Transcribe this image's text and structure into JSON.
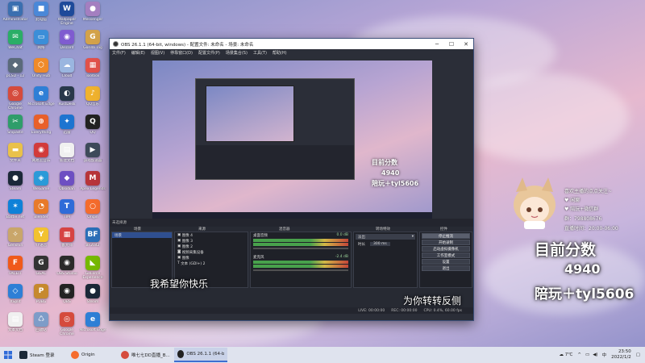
{
  "desktop": {
    "icons": [
      {
        "label": "Administrator",
        "glyph": "▣",
        "color": "#3a6fb0",
        "name": "admin-icon"
      },
      {
        "label": "此电脑",
        "glyph": "■",
        "color": "#4a88d8",
        "name": "this-pc-icon"
      },
      {
        "label": "Wallpaper Engine",
        "glyph": "W",
        "color": "#1e4a9a",
        "name": "wallpaper-engine-icon"
      },
      {
        "label": "Messenger",
        "glyph": "●",
        "color": "#a47fc0",
        "name": "messenger-icon"
      },
      {
        "label": "WeChat",
        "glyph": "✉",
        "color": "#2aae67",
        "name": "wechat-icon"
      },
      {
        "label": "网络",
        "glyph": "▭",
        "color": "#3b8ed8",
        "name": "network-icon"
      },
      {
        "label": "Discord",
        "glyph": "◉",
        "color": "#7f5cd0",
        "name": "discord-icon"
      },
      {
        "label": "Gorilla Tag",
        "glyph": "G",
        "color": "#d3a24a",
        "name": "gorilla-tag-icon"
      },
      {
        "label": "pCSD - 12",
        "glyph": "◆",
        "color": "#5a6a7a",
        "name": "pcsd-icon"
      },
      {
        "label": "Unity Hub",
        "glyph": "⬡",
        "color": "#ef8a2a",
        "name": "unity-hub-icon"
      },
      {
        "label": "Cloud",
        "glyph": "☁",
        "color": "#9ab6e0",
        "name": "cloud-icon"
      },
      {
        "label": "Toolbox",
        "glyph": "▦",
        "color": "#e2514a",
        "name": "toolbox-icon"
      },
      {
        "label": "Google Chrome",
        "glyph": "◎",
        "color": "#d54b3d",
        "name": "chrome-icon"
      },
      {
        "label": "Microsoft Edge",
        "glyph": "e",
        "color": "#2e7fd6",
        "name": "edge-icon"
      },
      {
        "label": "RustDesk",
        "glyph": "◐",
        "color": "#28384a",
        "name": "rustdesk-icon"
      },
      {
        "label": "QQ音乐",
        "glyph": "♪",
        "color": "#f0b22e",
        "name": "qqmusic-icon"
      },
      {
        "label": "Snipaste",
        "glyph": "✂",
        "color": "#2f9d6a",
        "name": "snipaste-icon"
      },
      {
        "label": "Everything",
        "glyph": "⊕",
        "color": "#e8602a",
        "name": "everything-icon"
      },
      {
        "label": "迅雷",
        "glyph": "✦",
        "color": "#1d74d0",
        "name": "xunlei-icon"
      },
      {
        "label": "QQ",
        "glyph": "Q",
        "color": "#222",
        "name": "qq-icon"
      },
      {
        "label": "文件夹",
        "glyph": "▬",
        "color": "#e9c14a",
        "name": "folder-icon"
      },
      {
        "label": "网易云音乐",
        "glyph": "◉",
        "color": "#d23b3b",
        "name": "netease-icon"
      },
      {
        "label": "新建文档",
        "glyph": "▤",
        "color": "#f0f0f0",
        "name": "new-doc-icon"
      },
      {
        "label": "游戏加速器",
        "glyph": "▶",
        "color": "#3e4a5a",
        "name": "accelerator-icon"
      },
      {
        "label": "Steam",
        "glyph": "●",
        "color": "#1b2838",
        "name": "steam-icon"
      },
      {
        "label": "WeGame",
        "glyph": "◈",
        "color": "#2a9ad8",
        "name": "wegame-icon"
      },
      {
        "label": "Obsidian",
        "glyph": "◆",
        "color": "#6d4fc2",
        "name": "obsidian-icon"
      },
      {
        "label": "Apex Legends",
        "glyph": "M",
        "color": "#b8353a",
        "name": "apex-icon"
      },
      {
        "label": "Battle.net",
        "glyph": "✶",
        "color": "#0e81d8",
        "name": "battlenet-icon"
      },
      {
        "label": "Blender",
        "glyph": "◔",
        "color": "#e87a2a",
        "name": "blender-icon"
      },
      {
        "label": "TIM",
        "glyph": "T",
        "color": "#2f6bd8",
        "name": "tim-icon"
      },
      {
        "label": "Origin",
        "glyph": "○",
        "color": "#f56c2d",
        "name": "origin-icon"
      },
      {
        "label": "Genshin",
        "glyph": "✧",
        "color": "#c9a66a",
        "name": "genshin-icon"
      },
      {
        "label": "YY语音",
        "glyph": "Y",
        "color": "#f2c230",
        "name": "yy-icon"
      },
      {
        "label": "鲁大师",
        "glyph": "▦",
        "color": "#d64343",
        "name": "ludashi-icon"
      },
      {
        "label": "BF2042",
        "glyph": "BF",
        "color": "#2c6fb8",
        "name": "bf-icon"
      },
      {
        "label": "FACEIT",
        "glyph": "F",
        "color": "#f05a1a",
        "name": "faceit-icon"
      },
      {
        "label": "GGAC",
        "glyph": "G",
        "color": "#333",
        "name": "ggac-icon"
      },
      {
        "label": "OBS Studio",
        "glyph": "◉",
        "color": "#2a2a2a",
        "name": "obs-desktop-icon"
      },
      {
        "label": "GeForce Experience",
        "glyph": "◣",
        "color": "#76b900",
        "name": "geforce-icon"
      },
      {
        "label": "XSplit",
        "glyph": "◇",
        "color": "#2e7fd6",
        "name": "xsplit-icon"
      },
      {
        "label": "PUBG",
        "glyph": "P",
        "color": "#c6892e",
        "name": "pubg-icon"
      },
      {
        "label": "OBS",
        "glyph": "◉",
        "color": "#222",
        "name": "obs2-icon"
      },
      {
        "label": "Steam",
        "glyph": "●",
        "color": "#1b2838",
        "name": "steam2-icon"
      },
      {
        "label": "文本文档",
        "glyph": "▤",
        "color": "#f0f0f0",
        "name": "text-doc-icon"
      },
      {
        "label": "回收站",
        "glyph": "♺",
        "color": "#7d9cc8",
        "name": "recycle-bin-icon"
      },
      {
        "label": "Google Chrome",
        "glyph": "◎",
        "color": "#d54b3d",
        "name": "chrome2-icon"
      },
      {
        "label": "Microsoft Edge",
        "glyph": "e",
        "color": "#2e7fd6",
        "name": "edge2-icon"
      }
    ]
  },
  "obs": {
    "title": "OBS 26.1.1 (64-bit, windows) - 配置文件: 未命名 - 场景: 未命名",
    "menu": [
      "文件(F)",
      "编辑(E)",
      "视图(V)",
      "停靠窗口(D)",
      "配置文件(P)",
      "场景集合(S)",
      "工具(T)",
      "帮助(H)"
    ],
    "scene_bar": "未选择源",
    "docks": {
      "scenes_header": "场景",
      "sources_header": "来源",
      "mixer_header": "混音器",
      "transitions_header": "转场特效",
      "controls_header": "控件"
    },
    "scenes": [
      "场景"
    ],
    "sources": [
      "图像 4",
      "图像 3",
      "图像 2",
      "视频采集设备",
      "图像",
      "文本 (GDI+) 2"
    ],
    "mixer": [
      {
        "name": "桌面音频",
        "value": "0.0 dB"
      },
      {
        "name": "麦克风",
        "value": "-2.4 dB"
      }
    ],
    "transition": {
      "type": "淡出",
      "duration_label": "时长",
      "duration": "300 ms"
    },
    "controls": [
      "停止推流",
      "开始录制",
      "启动虚拟摄像机",
      "工作室模式",
      "设置",
      "退出"
    ],
    "status": [
      "LIVE: 00:00:00",
      "REC: 00:00:00",
      "CPU: 0.4%, 60.00 fps"
    ]
  },
  "subtitles": {
    "line1": "我希望你快乐",
    "line2": "为你转转反侧"
  },
  "overlay": {
    "info": [
      "喜欢主播的点点关注~",
      "♥ 闲聊",
      "♥ 陪玩+微信群",
      "群：798808676",
      "直播时间：20:00-06:00"
    ],
    "score_label": "目前分数",
    "score_value": "4940",
    "companion": "陪玩＋tyl5606"
  },
  "taskbar": {
    "items": [
      {
        "label": "",
        "name": "start-button"
      },
      {
        "label": "Steam 登录",
        "name": "taskbar-steam"
      },
      {
        "label": "Origin",
        "name": "taskbar-origin"
      },
      {
        "label": "唯七七DD直播_B...",
        "name": "taskbar-chrome"
      },
      {
        "label": "OBS 26.1.1 (64-bit...",
        "name": "taskbar-obs"
      }
    ],
    "weather": "7℃",
    "lang": "中",
    "time": "23:50",
    "date": "2022/1/2"
  }
}
